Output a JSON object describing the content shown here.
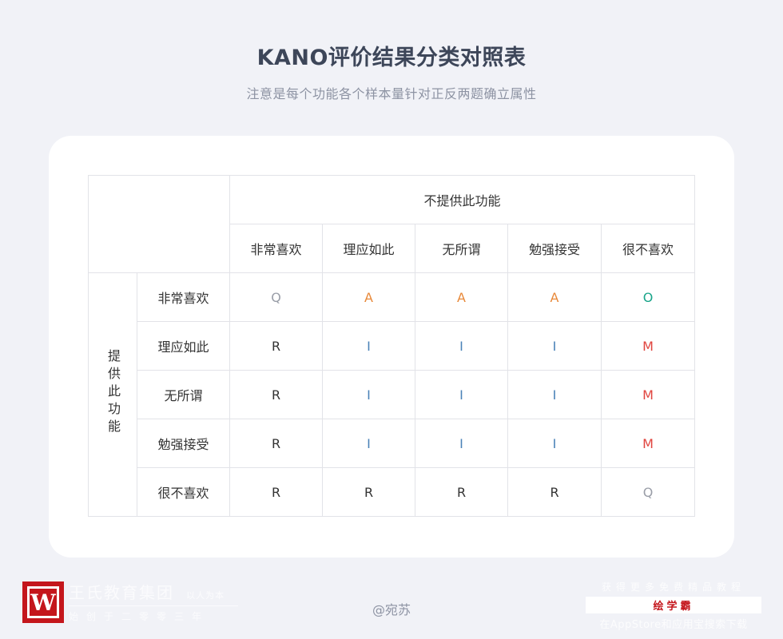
{
  "header": {
    "title": "KANO评价结果分类对照表",
    "subtitle": "注意是每个功能各个样本量针对正反两题确立属性"
  },
  "table": {
    "col_group_label": "不提供此功能",
    "row_group_label": "提供此功能",
    "col_headers": [
      "非常喜欢",
      "理应如此",
      "无所谓",
      "勉强接受",
      "很不喜欢"
    ],
    "rows": [
      {
        "label": "非常喜欢",
        "cells": [
          "Q",
          "A",
          "A",
          "A",
          "O"
        ]
      },
      {
        "label": "理应如此",
        "cells": [
          "R",
          "I",
          "I",
          "I",
          "M"
        ]
      },
      {
        "label": "无所谓",
        "cells": [
          "R",
          "I",
          "I",
          "I",
          "M"
        ]
      },
      {
        "label": "勉强接受",
        "cells": [
          "R",
          "I",
          "I",
          "I",
          "M"
        ]
      },
      {
        "label": "很不喜欢",
        "cells": [
          "R",
          "R",
          "R",
          "R",
          "Q"
        ]
      }
    ],
    "value_colors": {
      "Q": "#9a9ea8",
      "A": "#e8893a",
      "O": "#1aa58a",
      "R": "#333333",
      "I": "#4a82b8",
      "M": "#e0443e"
    }
  },
  "footer": {
    "author": "@宛苏",
    "brand_name": "王氏教育集团",
    "brand_motto": "以人为本",
    "brand_tagline": "始创于二零零三年",
    "promo_top": "获得更多免费精品教程",
    "promo_brand": "绘学霸",
    "promo_bottom": "在AppStore和应用宝搜索下载"
  }
}
